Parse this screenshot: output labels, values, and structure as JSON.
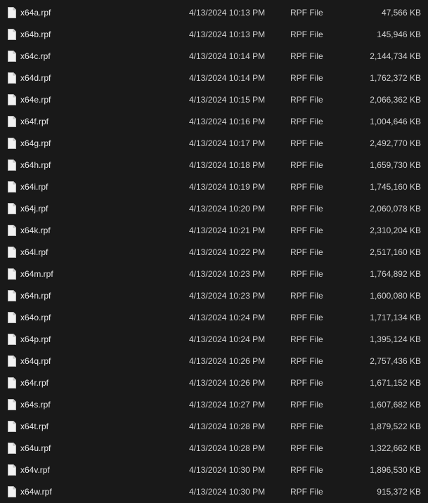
{
  "colors": {
    "background": "#191919",
    "text": "#e6e6e6",
    "icon": "#f2f2f2"
  },
  "icons": {
    "file": "document-file-icon"
  },
  "files": [
    {
      "name": "x64a.rpf",
      "date": "4/13/2024 10:13 PM",
      "type": "RPF File",
      "size": "47,566 KB"
    },
    {
      "name": "x64b.rpf",
      "date": "4/13/2024 10:13 PM",
      "type": "RPF File",
      "size": "145,946 KB"
    },
    {
      "name": "x64c.rpf",
      "date": "4/13/2024 10:14 PM",
      "type": "RPF File",
      "size": "2,144,734 KB"
    },
    {
      "name": "x64d.rpf",
      "date": "4/13/2024 10:14 PM",
      "type": "RPF File",
      "size": "1,762,372 KB"
    },
    {
      "name": "x64e.rpf",
      "date": "4/13/2024 10:15 PM",
      "type": "RPF File",
      "size": "2,066,362 KB"
    },
    {
      "name": "x64f.rpf",
      "date": "4/13/2024 10:16 PM",
      "type": "RPF File",
      "size": "1,004,646 KB"
    },
    {
      "name": "x64g.rpf",
      "date": "4/13/2024 10:17 PM",
      "type": "RPF File",
      "size": "2,492,770 KB"
    },
    {
      "name": "x64h.rpf",
      "date": "4/13/2024 10:18 PM",
      "type": "RPF File",
      "size": "1,659,730 KB"
    },
    {
      "name": "x64i.rpf",
      "date": "4/13/2024 10:19 PM",
      "type": "RPF File",
      "size": "1,745,160 KB"
    },
    {
      "name": "x64j.rpf",
      "date": "4/13/2024 10:20 PM",
      "type": "RPF File",
      "size": "2,060,078 KB"
    },
    {
      "name": "x64k.rpf",
      "date": "4/13/2024 10:21 PM",
      "type": "RPF File",
      "size": "2,310,204 KB"
    },
    {
      "name": "x64l.rpf",
      "date": "4/13/2024 10:22 PM",
      "type": "RPF File",
      "size": "2,517,160 KB"
    },
    {
      "name": "x64m.rpf",
      "date": "4/13/2024 10:23 PM",
      "type": "RPF File",
      "size": "1,764,892 KB"
    },
    {
      "name": "x64n.rpf",
      "date": "4/13/2024 10:23 PM",
      "type": "RPF File",
      "size": "1,600,080 KB"
    },
    {
      "name": "x64o.rpf",
      "date": "4/13/2024 10:24 PM",
      "type": "RPF File",
      "size": "1,717,134 KB"
    },
    {
      "name": "x64p.rpf",
      "date": "4/13/2024 10:24 PM",
      "type": "RPF File",
      "size": "1,395,124 KB"
    },
    {
      "name": "x64q.rpf",
      "date": "4/13/2024 10:26 PM",
      "type": "RPF File",
      "size": "2,757,436 KB"
    },
    {
      "name": "x64r.rpf",
      "date": "4/13/2024 10:26 PM",
      "type": "RPF File",
      "size": "1,671,152 KB"
    },
    {
      "name": "x64s.rpf",
      "date": "4/13/2024 10:27 PM",
      "type": "RPF File",
      "size": "1,607,682 KB"
    },
    {
      "name": "x64t.rpf",
      "date": "4/13/2024 10:28 PM",
      "type": "RPF File",
      "size": "1,879,522 KB"
    },
    {
      "name": "x64u.rpf",
      "date": "4/13/2024 10:28 PM",
      "type": "RPF File",
      "size": "1,322,662 KB"
    },
    {
      "name": "x64v.rpf",
      "date": "4/13/2024 10:30 PM",
      "type": "RPF File",
      "size": "1,896,530 KB"
    },
    {
      "name": "x64w.rpf",
      "date": "4/13/2024 10:30 PM",
      "type": "RPF File",
      "size": "915,372 KB"
    }
  ]
}
